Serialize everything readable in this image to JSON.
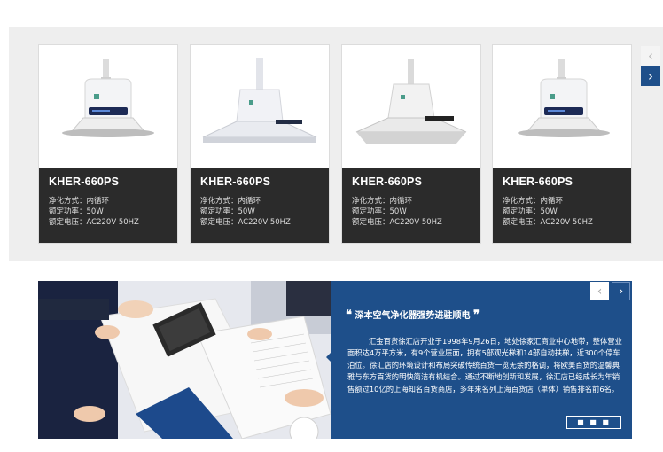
{
  "products": [
    {
      "model": "KHER-660PS",
      "specs": [
        "净化方式：内循环",
        "额定功率：50W",
        "额定电压：AC220V 50HZ"
      ],
      "image_icon": "round-purifier-hood-image"
    },
    {
      "model": "KHER-660PS",
      "specs": [
        "净化方式：内循环",
        "额定功率：50W",
        "额定电压：AC220V 50HZ"
      ],
      "image_icon": "square-purifier-hood-image"
    },
    {
      "model": "KHER-660PS",
      "specs": [
        "净化方式：内循环",
        "额定功率：50W",
        "额定电压：AC220V 50HZ"
      ],
      "image_icon": "square-purifier-hood-image"
    },
    {
      "model": "KHER-660PS",
      "specs": [
        "净化方式：内循环",
        "额定功率：50W",
        "额定电压：AC220V 50HZ"
      ],
      "image_icon": "round-purifier-hood-image"
    }
  ],
  "carousel": {
    "prev_icon": "‹",
    "next_icon": "›"
  },
  "news": {
    "quote_open": "❝",
    "quote_close": "❞",
    "headline": "深本空气净化器强势进驻顺电",
    "body": "汇金百货徐汇店开业于1998年9月26日，地处徐家汇商业中心地带，整体营业面积达4万平方米，有9个营业层面，拥有5部观光梯和14部自动扶梯，近300个停车泊位。徐汇店的环境设计和布局突破传统百货一览无余的格调，将欧美百货的温馨典雅与东方百货的明快简洁有机结合。通过不断地创新和发展，徐汇店已经成长为年销售额过10亿的上海知名百货商店，多年来名列上海百货店（单体）销售排名前6名。",
    "more_label": "■ ■ ■",
    "prev_icon": "‹",
    "next_icon": "›"
  },
  "colors": {
    "accent": "#1e4f8a",
    "card_info_bg": "#2b2b2b",
    "band_bg": "#eeeeee"
  }
}
